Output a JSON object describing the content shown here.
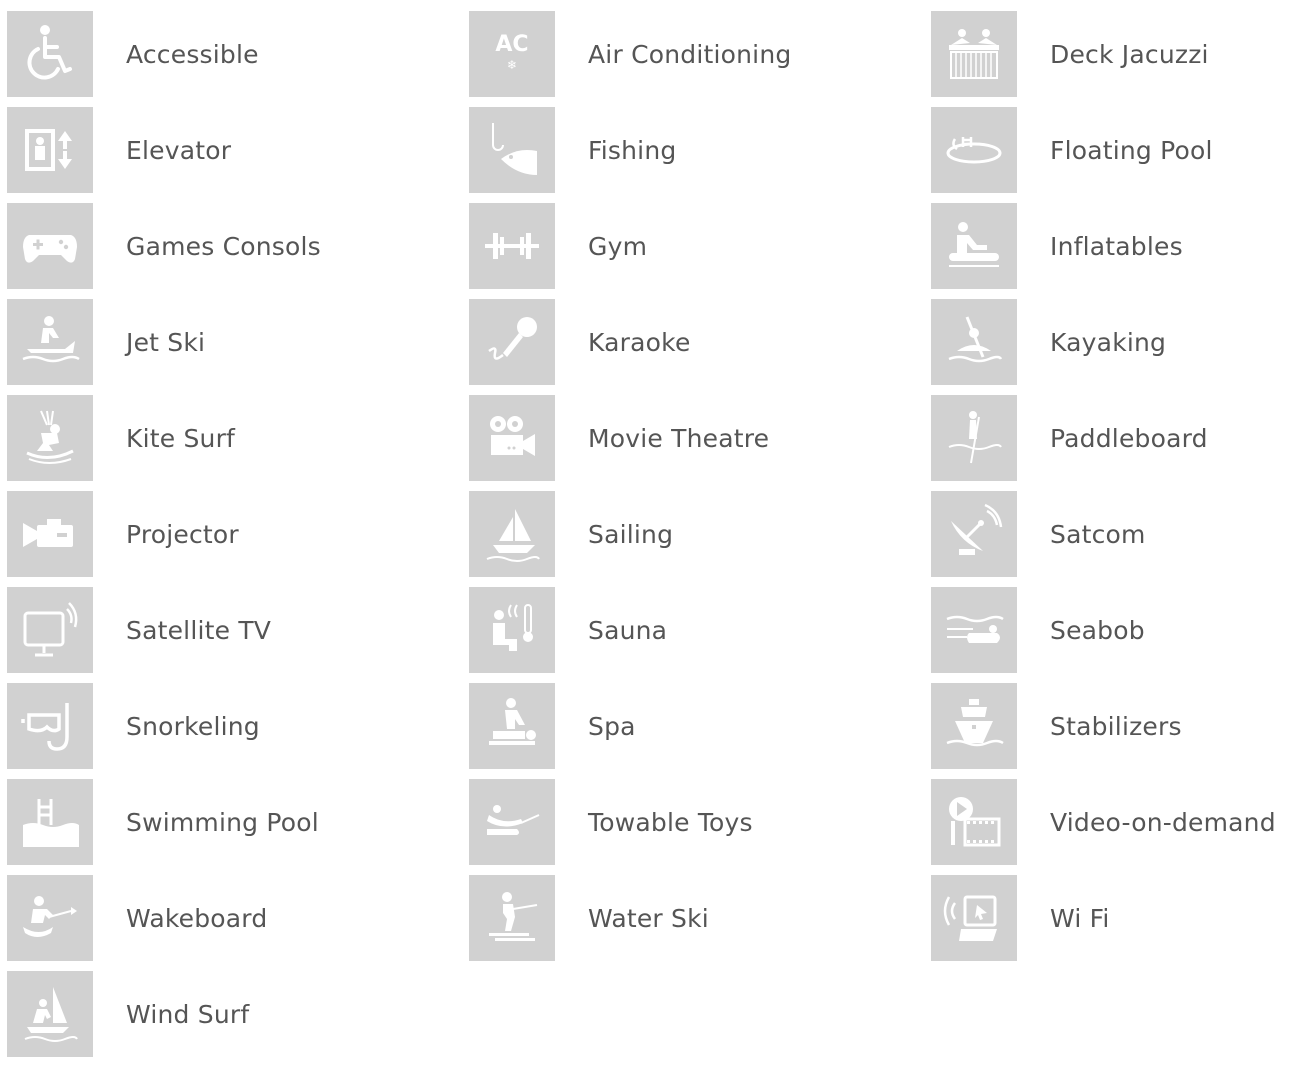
{
  "amenities": [
    {
      "label": "Accessible",
      "icon": "wheelchair-icon"
    },
    {
      "label": "Air Conditioning",
      "icon": "air-conditioning-icon"
    },
    {
      "label": "Deck Jacuzzi",
      "icon": "deck-jacuzzi-icon"
    },
    {
      "label": "Elevator",
      "icon": "elevator-icon"
    },
    {
      "label": "Fishing",
      "icon": "fishing-icon"
    },
    {
      "label": "Floating Pool",
      "icon": "floating-pool-icon"
    },
    {
      "label": "Games Consols",
      "icon": "game-controller-icon"
    },
    {
      "label": "Gym",
      "icon": "dumbbell-icon"
    },
    {
      "label": "Inflatables",
      "icon": "inflatables-icon"
    },
    {
      "label": "Jet Ski",
      "icon": "jet-ski-icon"
    },
    {
      "label": "Karaoke",
      "icon": "microphone-icon"
    },
    {
      "label": "Kayaking",
      "icon": "kayak-icon"
    },
    {
      "label": "Kite Surf",
      "icon": "kite-surf-icon"
    },
    {
      "label": "Movie Theatre",
      "icon": "movie-camera-icon"
    },
    {
      "label": "Paddleboard",
      "icon": "paddleboard-icon"
    },
    {
      "label": "Projector",
      "icon": "projector-icon"
    },
    {
      "label": "Sailing",
      "icon": "sailboat-icon"
    },
    {
      "label": "Satcom",
      "icon": "satellite-dish-icon"
    },
    {
      "label": "Satellite TV",
      "icon": "satellite-tv-icon"
    },
    {
      "label": "Sauna",
      "icon": "sauna-icon"
    },
    {
      "label": "Seabob",
      "icon": "seabob-icon"
    },
    {
      "label": "Snorkeling",
      "icon": "snorkel-mask-icon"
    },
    {
      "label": "Spa",
      "icon": "massage-icon"
    },
    {
      "label": "Stabilizers",
      "icon": "stabilizer-ship-icon"
    },
    {
      "label": "Swimming Pool",
      "icon": "swimming-pool-icon"
    },
    {
      "label": "Towable Toys",
      "icon": "towable-toy-icon"
    },
    {
      "label": "Video-on-demand",
      "icon": "video-on-demand-icon"
    },
    {
      "label": "Wakeboard",
      "icon": "wakeboard-icon"
    },
    {
      "label": "Water Ski",
      "icon": "water-ski-icon"
    },
    {
      "label": "Wi Fi",
      "icon": "wifi-laptop-icon"
    },
    {
      "label": "Wind Surf",
      "icon": "windsurf-icon"
    }
  ],
  "colors": {
    "tile_background": "#d1d1d1",
    "icon_foreground": "#ffffff",
    "label_text": "#555555"
  }
}
